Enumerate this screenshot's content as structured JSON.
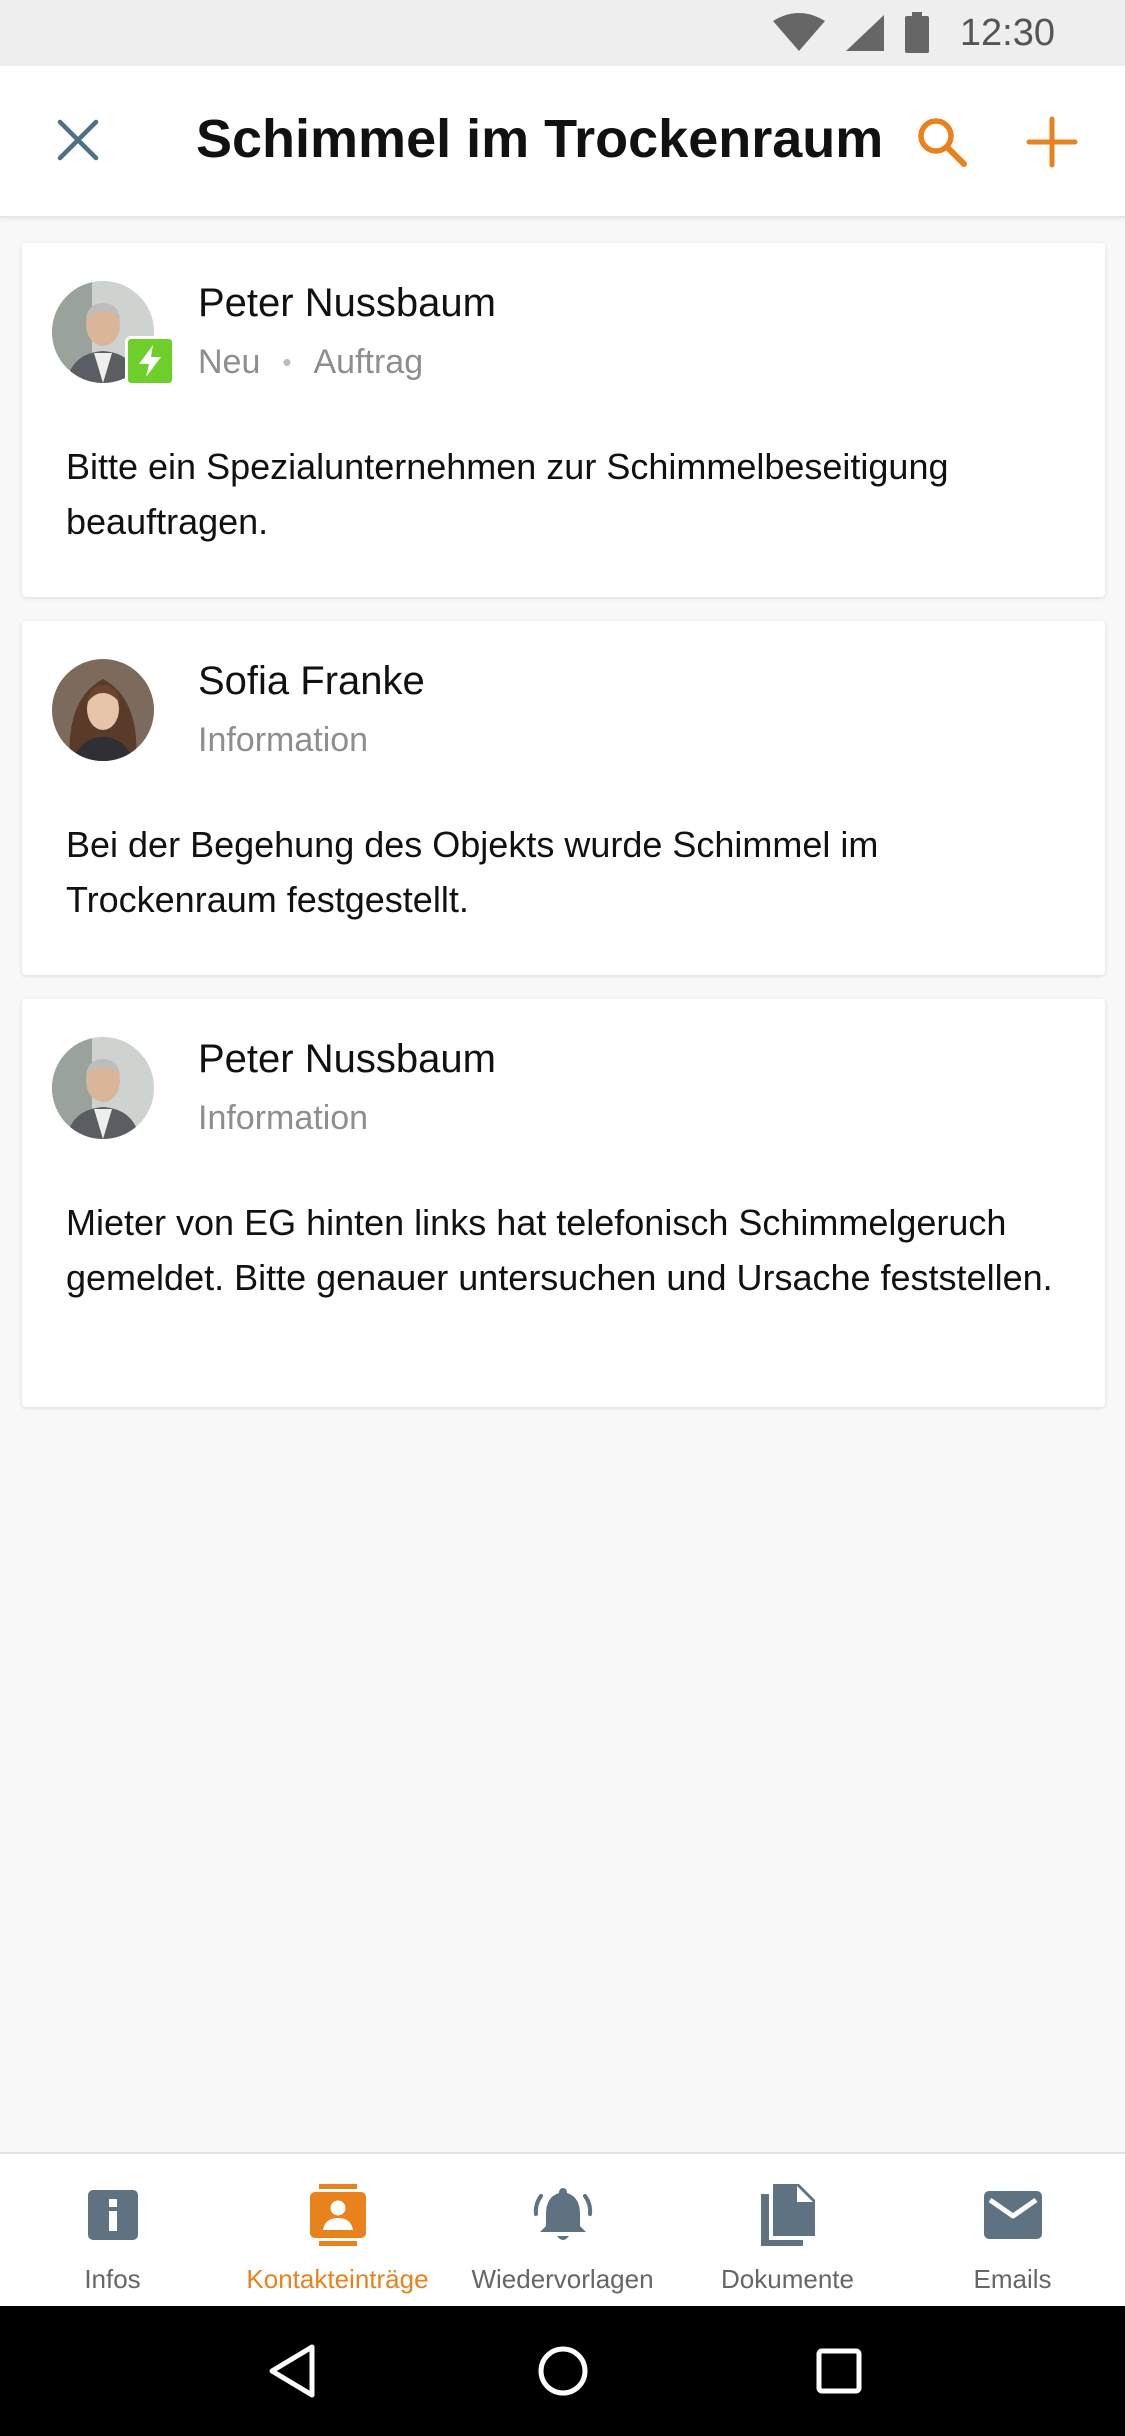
{
  "status_bar": {
    "time": "12:30"
  },
  "app_bar": {
    "title": "Schimmel im Trockenraum"
  },
  "colors": {
    "accent": "#e8821c",
    "badge": "#6fcf2a"
  },
  "entries": [
    {
      "name": "Peter Nussbaum",
      "status": "Neu",
      "type": "Auftrag",
      "has_badge": true,
      "text": "Bitte ein Spezialunternehmen zur Schimmelbeseitigung beauftragen."
    },
    {
      "name": "Sofia Franke",
      "type": "Information",
      "text": "Bei der Begehung des Objekts wurde Schimmel im Trockenraum festgestellt."
    },
    {
      "name": "Peter Nussbaum",
      "type": "Information",
      "text": "Mieter von EG hinten links hat telefonisch Schimmelgeruch gemeldet. Bitte genauer untersuchen und Ursache feststellen."
    }
  ],
  "bottom_nav": {
    "items": [
      {
        "label": "Infos",
        "icon": "info-icon"
      },
      {
        "label": "Kontakteinträge",
        "icon": "contact-card-icon",
        "active": true
      },
      {
        "label": "Wiedervorlagen",
        "icon": "bell-icon"
      },
      {
        "label": "Dokumente",
        "icon": "documents-icon"
      },
      {
        "label": "Emails",
        "icon": "mail-icon"
      }
    ]
  }
}
